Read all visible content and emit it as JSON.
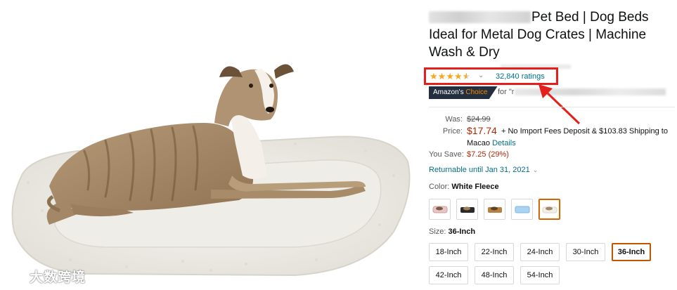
{
  "product": {
    "title_line1": "Pet Bed | Dog Beds",
    "title_line2": "Ideal for Metal Dog Crates | Machine",
    "title_line3": "Wash & Dry"
  },
  "rating": {
    "stars": 4.5,
    "count_label": "32,840 ratings"
  },
  "badge": {
    "choice_part1": "Amazon's",
    "choice_part2": "Choice",
    "for_text": "for \"r"
  },
  "pricing": {
    "was_label": "Was:",
    "was_value": "$24.99",
    "price_label": "Price:",
    "price_value": "$17.74",
    "price_note_line1": "+ No Import Fees Deposit & $103.83 Shipping to",
    "price_note_line2_prefix": "Macao",
    "details_link": "Details",
    "save_label": "You Save:",
    "save_value": "$7.25 (29%)"
  },
  "returnable": {
    "text": "Returnable until Jan 31, 2021"
  },
  "color": {
    "label": "Color:",
    "selected": "White Fleece",
    "swatches": [
      "pink-fleece",
      "black",
      "brown",
      "blue",
      "white-fleece"
    ]
  },
  "size": {
    "label": "Size:",
    "selected": "36-Inch",
    "options": [
      "18-Inch",
      "22-Inch",
      "24-Inch",
      "30-Inch",
      "36-Inch",
      "42-Inch",
      "48-Inch",
      "54-Inch"
    ]
  },
  "watermark": {
    "text": "大数跨境"
  },
  "colors": {
    "link": "#007185",
    "price": "#b12704",
    "star": "#ffa41c",
    "highlight": "#e3201b",
    "selected_border": "#c45500"
  }
}
